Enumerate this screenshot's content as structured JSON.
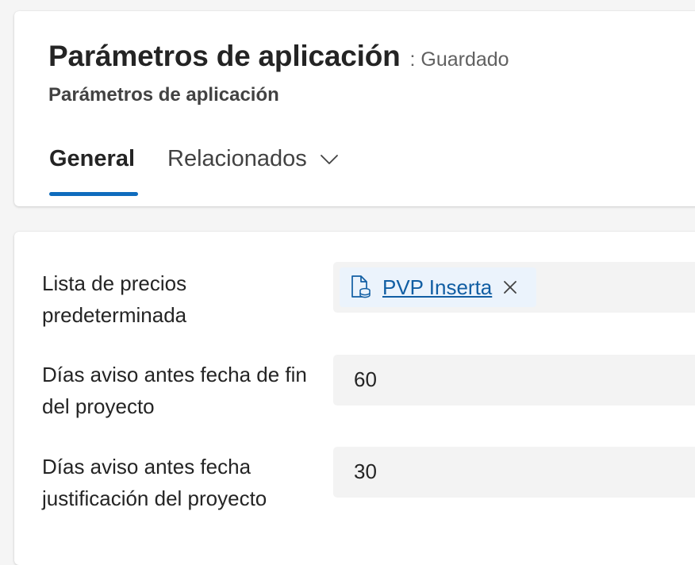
{
  "header": {
    "title": "Parámetros de aplicación",
    "save_status": ": Guardado",
    "subtitle": "Parámetros de aplicación"
  },
  "tabs": [
    {
      "label": "General",
      "selected": true
    },
    {
      "label": "Relacionados",
      "selected": false,
      "icon": "chevron-down-icon"
    }
  ],
  "form": {
    "price_list": {
      "label": "Lista de precios predeterminada",
      "value": "PVP Inserta",
      "icon": "price-list-icon"
    },
    "days_before_end": {
      "label": "Días aviso antes fecha de fin del proyecto",
      "value": "60"
    },
    "days_before_justification": {
      "label": "Días aviso antes fecha justificación del proyecto",
      "value": "30"
    }
  },
  "colors": {
    "accent": "#0f6cbd",
    "link": "#115ea3",
    "tag_background": "#ebf3fc",
    "input_background": "#f3f3f3"
  }
}
